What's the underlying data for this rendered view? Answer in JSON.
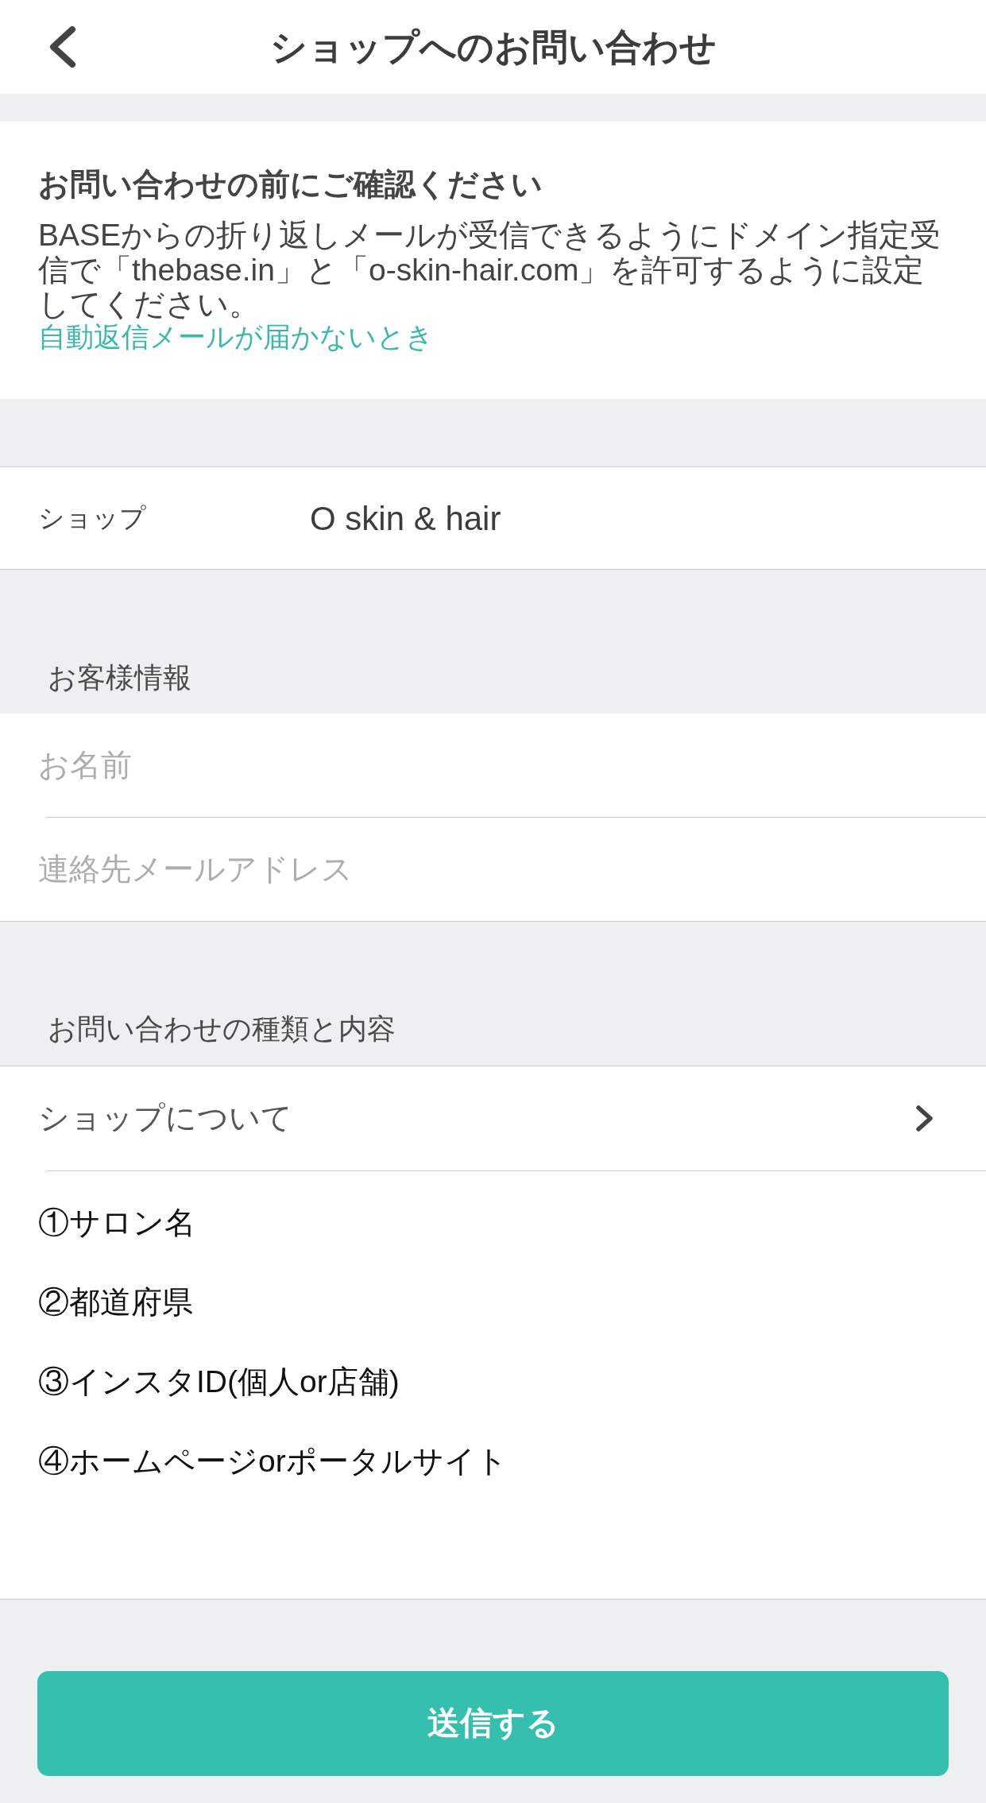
{
  "header": {
    "title": "ショップへのお問い合わせ"
  },
  "notice": {
    "heading": "お問い合わせの前にご確認ください",
    "body": "BASEからの折り返しメールが受信できるようにドメイン指定受信で「thebase.in」と「o-skin-hair.com」を許可するように設定してください。",
    "link": "自動返信メールが届かないとき"
  },
  "shop": {
    "label": "ショップ",
    "value": "O skin & hair"
  },
  "customer_info": {
    "title": "お客様情報",
    "fields": [
      {
        "placeholder": "お名前"
      },
      {
        "placeholder": "連絡先メールアドレス"
      }
    ]
  },
  "inquiry": {
    "title": "お問い合わせの種類と内容",
    "type": "ショップについて",
    "message_lines": [
      "①サロン名",
      "②都道府県",
      "③インスタID(個人or店舗)",
      "④ホームページorポータルサイト"
    ]
  },
  "submit_button": "送信する"
}
